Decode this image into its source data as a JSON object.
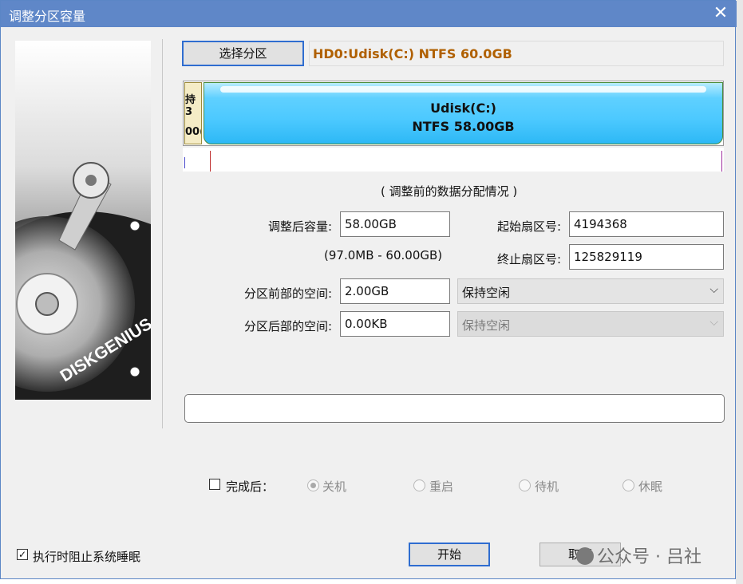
{
  "window": {
    "title": "调整分区容量",
    "close_icon": "close-icon"
  },
  "disk": {
    "select_button": "选择分区",
    "info": "HD0:Udisk(C:) NTFS 60.0GB",
    "small_partition": {
      "line1": "持3",
      "line2": "00("
    },
    "main_partition": {
      "name": "Udisk(C:)",
      "detail": "NTFS 58.00GB"
    }
  },
  "form": {
    "caption": "( 调整前的数据分配情况 )",
    "size_label": "调整后容量:",
    "size_value": "58.00GB",
    "range": "(97.0MB - 60.00GB)",
    "start_label": "起始扇区号:",
    "start_value": "4194368",
    "end_label": "终止扇区号:",
    "end_value": "125829119",
    "before_label": "分区前部的空间:",
    "before_value": "2.00GB",
    "before_option": "保持空闲",
    "after_label": "分区后部的空间:",
    "after_value": "0.00KB",
    "after_option": "保持空闲"
  },
  "after_finish": {
    "label": "完成后：",
    "checked": false,
    "options": [
      "关机",
      "重启",
      "待机",
      "休眠"
    ],
    "selected": 0
  },
  "footer": {
    "prevent_sleep_label": "执行时阻止系统睡眠",
    "prevent_sleep_checked": true,
    "start_button": "开始",
    "cancel_button": "取消"
  },
  "branding": {
    "logo_text": "DISKGENIUS"
  },
  "watermark": "公众号 · 吕社",
  "colors": {
    "titlebar": "#5f87c8",
    "partition": "#4cc9ff",
    "disk_info": "#b06000"
  }
}
